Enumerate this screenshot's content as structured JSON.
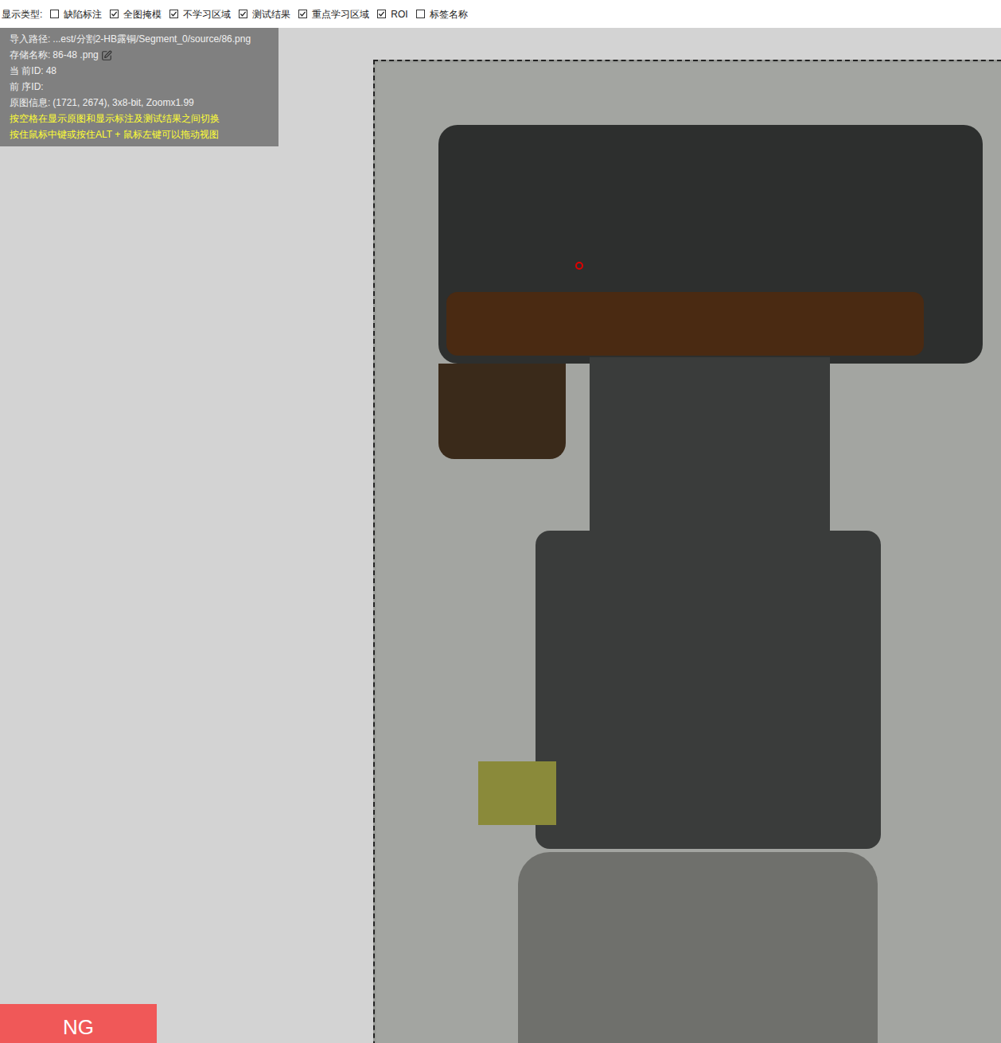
{
  "toolbar": {
    "label": "显示类型:",
    "options": [
      {
        "label": "缺陷标注",
        "checked": false
      },
      {
        "label": "全图掩模",
        "checked": true
      },
      {
        "label": "不学习区域",
        "checked": true
      },
      {
        "label": "测试结果",
        "checked": true
      },
      {
        "label": "重点学习区域",
        "checked": true
      },
      {
        "label": "ROI",
        "checked": true
      },
      {
        "label": "标签名称",
        "checked": false
      }
    ]
  },
  "info_panel": {
    "lines": [
      {
        "label": "导入路径:",
        "value": "...est/分割2-HB露铜/Segment_0/source/86.png",
        "editable": false
      },
      {
        "label": "存储名称:",
        "value": "86-48  .png",
        "editable": true
      },
      {
        "label": "当 前ID:",
        "value": "48",
        "editable": false
      },
      {
        "label": "前 序ID:",
        "value": "",
        "editable": false
      },
      {
        "label": "原图信息:",
        "value": "(1721, 2674), 3x8-bit, Zoomx1.99",
        "editable": false
      }
    ],
    "hints": [
      "按空格在显示原图和显示标注及测试结果之间切换",
      "按住鼠标中键或按住ALT + 鼠标左键可以拖动视图"
    ]
  },
  "result": {
    "label": "NG"
  }
}
